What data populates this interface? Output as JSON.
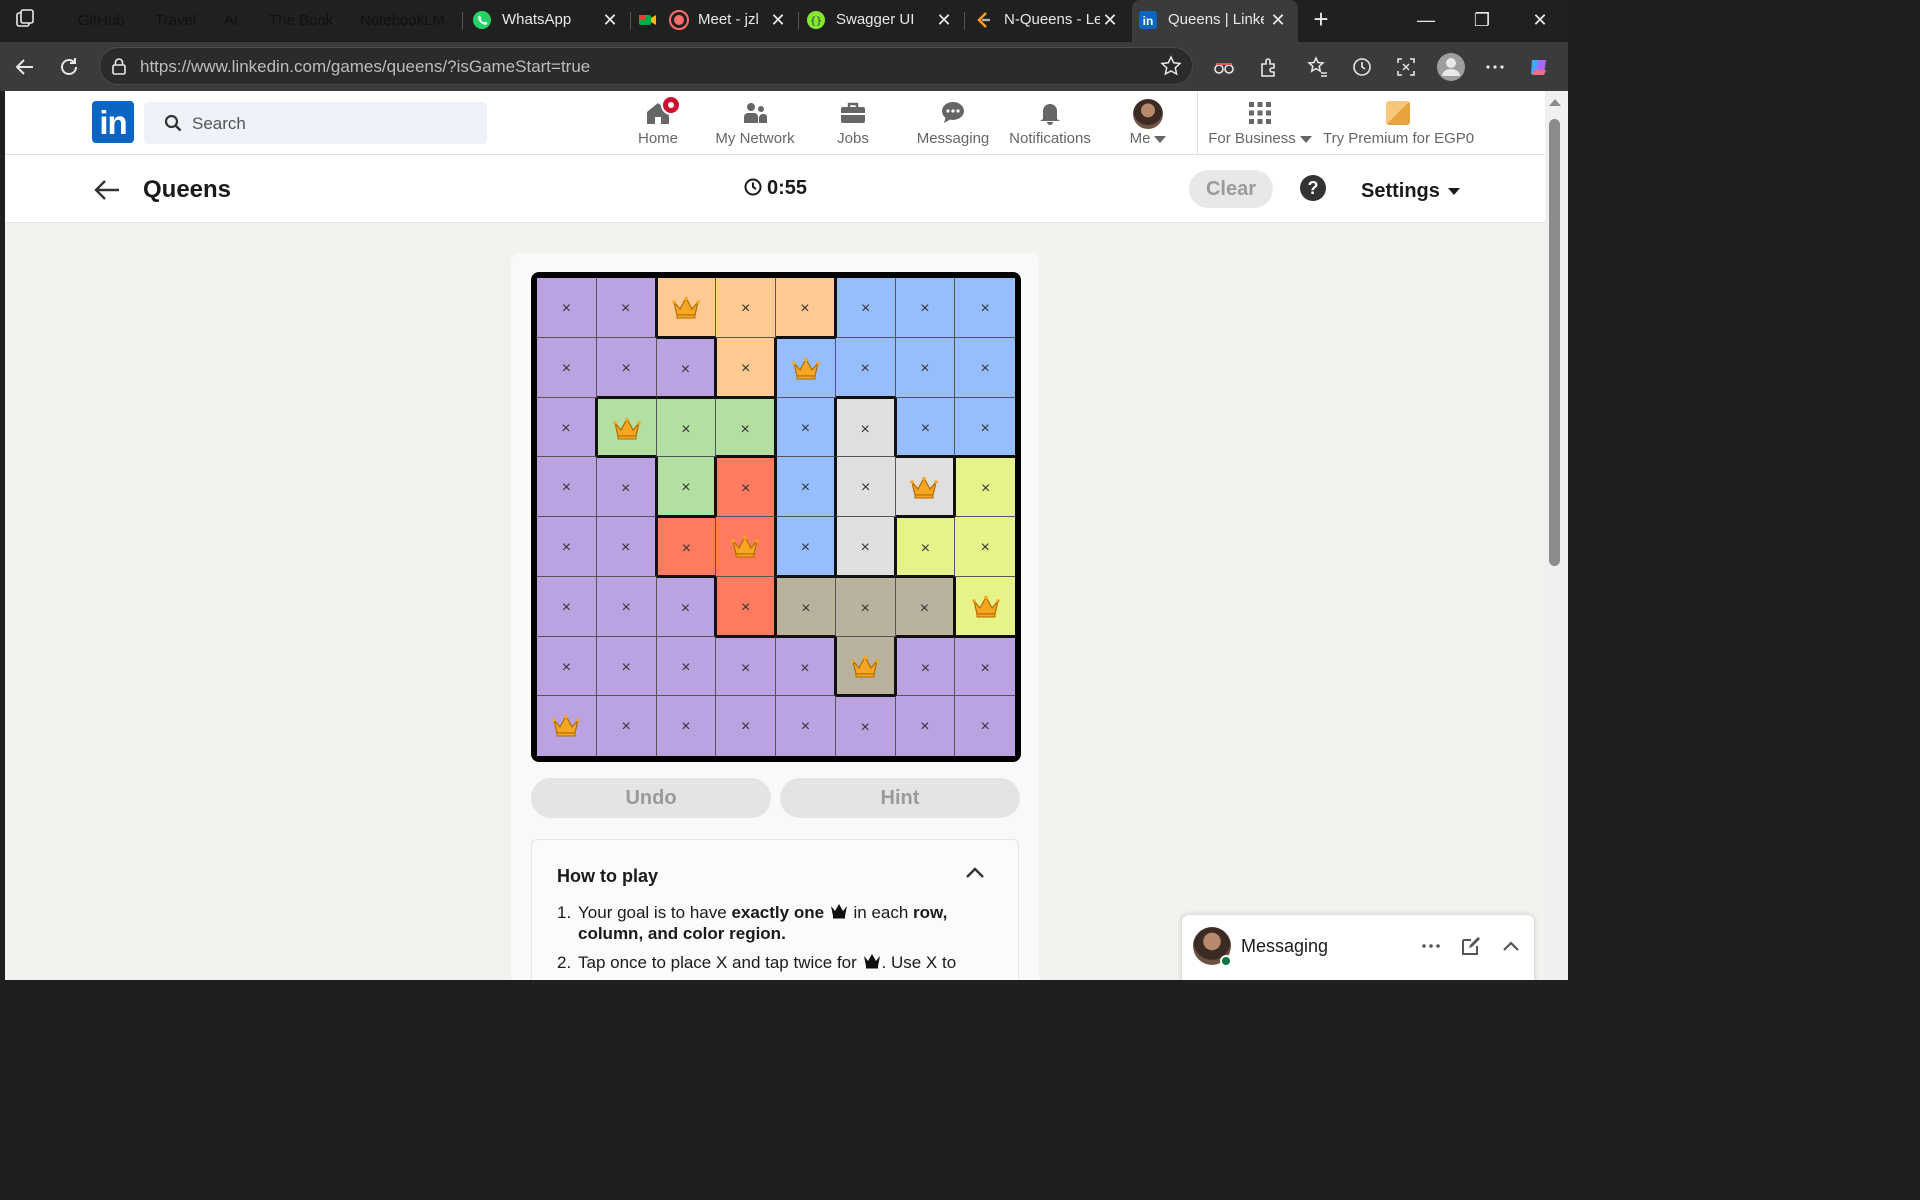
{
  "browser": {
    "tab_groups": [
      {
        "label": "GitHub",
        "color": "#6aa0ff"
      },
      {
        "label": "Travel",
        "color": "#ff6eb4"
      },
      {
        "label": "AI",
        "color": "#c58af9"
      },
      {
        "label": "The Book",
        "color": "#a58bf5"
      },
      {
        "label": "NotebookLM",
        "color": "#ff5fa8"
      }
    ],
    "tabs": [
      {
        "title": "WhatsApp",
        "icon": "whatsapp-icon"
      },
      {
        "title": "Meet - jzl",
        "icon": "meet-icon"
      },
      {
        "title": "Swagger UI",
        "icon": "swagger-icon"
      },
      {
        "title": "N-Queens - Le",
        "icon": "leetcode-icon"
      },
      {
        "title": "Queens | Linke",
        "icon": "linkedin-icon",
        "active": true
      }
    ],
    "url_host": "https://www.linkedin.com",
    "url_path": "/games/queens/?isGameStart=true"
  },
  "header": {
    "search_placeholder": "Search",
    "nav": [
      {
        "label": "Home",
        "icon": "home-icon"
      },
      {
        "label": "My Network",
        "icon": "network-icon"
      },
      {
        "label": "Jobs",
        "icon": "briefcase-icon"
      },
      {
        "label": "Messaging",
        "icon": "chat-icon"
      },
      {
        "label": "Notifications",
        "icon": "bell-icon"
      },
      {
        "label": "Me",
        "icon": "avatar"
      },
      {
        "label": "For Business",
        "icon": "grid-icon"
      },
      {
        "label": "Try Premium for EGP0",
        "icon": "premium-icon"
      }
    ],
    "logo_text": "in"
  },
  "game": {
    "title": "Queens",
    "timer": "0:55",
    "clear_label": "Clear",
    "help_label": "?",
    "settings_label": "Settings",
    "undo_label": "Undo",
    "hint_label": "Hint",
    "region_colors": {
      "P": "#bba3e2",
      "O": "#ffc992",
      "B": "#96beff",
      "G": "#b3dfa0",
      "W": "#dfdfdf",
      "R": "#ff7b60",
      "Y": "#e6f388",
      "T": "#b9b29e"
    },
    "regions": [
      "PPOOOBBB",
      "PPPOBBBB",
      "PGGGBWBB",
      "PPGRBWWY",
      "PPRRBWYY",
      "PPPRTTTY",
      "PPPPPTPP",
      "PPPPPPPP"
    ],
    "queens": [
      [
        0,
        2
      ],
      [
        1,
        4
      ],
      [
        2,
        1
      ],
      [
        3,
        6
      ],
      [
        4,
        3
      ],
      [
        5,
        7
      ],
      [
        6,
        5
      ],
      [
        7,
        0
      ]
    ],
    "x_mark": "×"
  },
  "how_to_play": {
    "title": "How to play",
    "item1_num": "1.",
    "item1_a": "Your goal is to have ",
    "item1_b": "exactly one",
    "item1_c": " in each ",
    "item1_d": "row, column, and color region.",
    "item2_num": "2.",
    "item2_a": "Tap once to place X and tap twice for",
    "item2_b": ". Use X to"
  },
  "messaging_dock": {
    "label": "Messaging"
  }
}
